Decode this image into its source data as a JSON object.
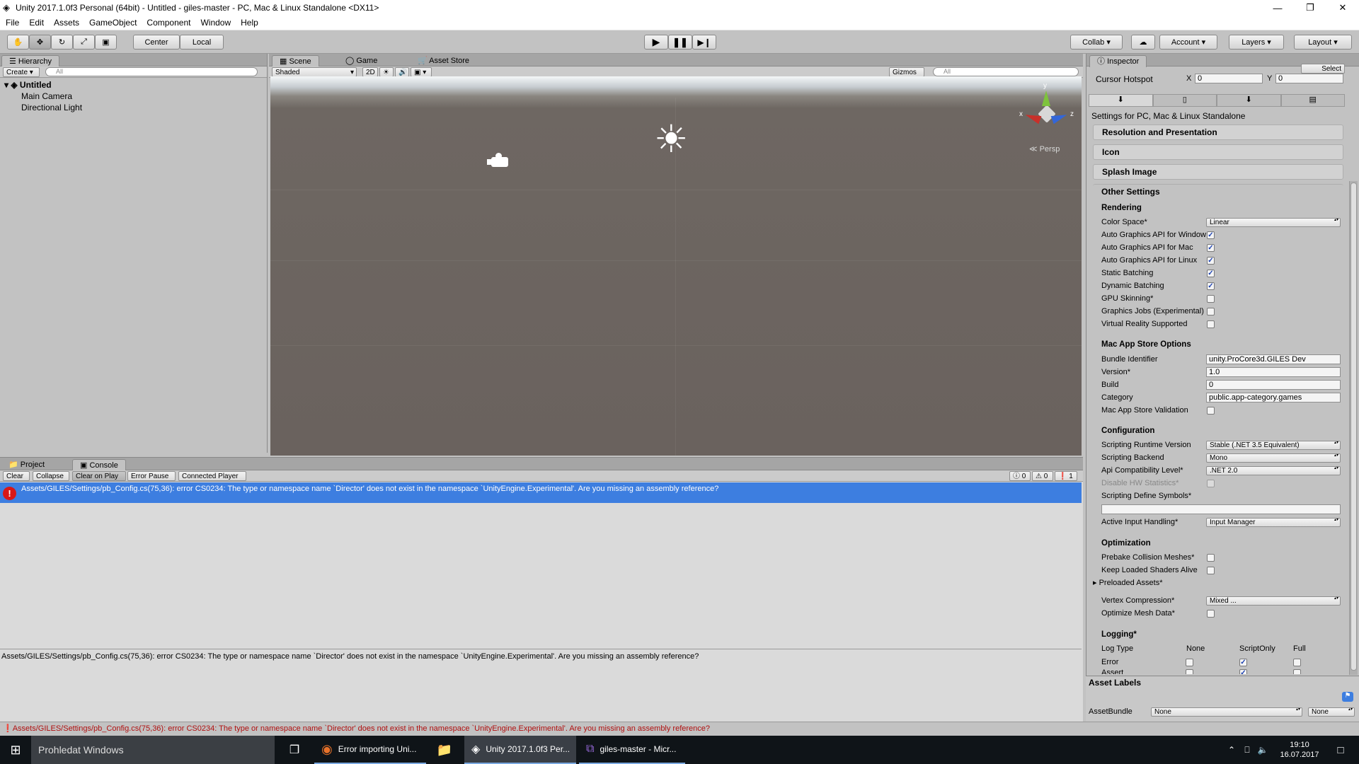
{
  "window": {
    "title": "Unity 2017.1.0f3 Personal (64bit) - Untitled - giles-master - PC, Mac & Linux Standalone <DX11>"
  },
  "menu": [
    "File",
    "Edit",
    "Assets",
    "GameObject",
    "Component",
    "Window",
    "Help"
  ],
  "toolbar": {
    "center": "Center",
    "local": "Local",
    "collab": "Collab",
    "account": "Account",
    "layers": "Layers",
    "layout": "Layout"
  },
  "hierarchy": {
    "tab": "Hierarchy",
    "create": "Create",
    "search_placeholder": "All",
    "scene_name": "Untitled",
    "items": [
      "Main Camera",
      "Directional Light"
    ]
  },
  "scene": {
    "tabs": [
      "Scene",
      "Game",
      "Asset Store"
    ],
    "shading": "Shaded",
    "mode_2d": "2D",
    "gizmos": "Gizmos",
    "search_placeholder": "All",
    "persp": "Persp",
    "axis": {
      "x": "x",
      "y": "y",
      "z": "z"
    }
  },
  "bottom": {
    "tabs": [
      "Project",
      "Console"
    ],
    "buttons": [
      "Clear",
      "Collapse",
      "Clear on Play",
      "Error Pause",
      "Connected Player"
    ],
    "counts": {
      "info": "0",
      "warn": "0",
      "error": "1"
    },
    "log_entry": "Assets/GILES/Settings/pb_Config.cs(75,36): error CS0234: The type or namespace name `Director' does not exist in the namespace `UnityEngine.Experimental'. Are you missing an assembly reference?",
    "detail": "Assets/GILES/Settings/pb_Config.cs(75,36): error CS0234: The type or namespace name `Director' does not exist in the namespace `UnityEngine.Experimental'. Are you missing an assembly reference?"
  },
  "status_bar": "Assets/GILES/Settings/pb_Config.cs(75,36): error CS0234: The type or namespace name `Director' does not exist in the namespace `UnityEngine.Experimental'. Are you missing an assembly reference?",
  "inspector": {
    "tab": "Inspector",
    "select": "Select",
    "cursor_hotspot": {
      "label": "Cursor Hotspot",
      "x_label": "X",
      "x": "0",
      "y_label": "Y",
      "y": "0"
    },
    "settings_for": "Settings for PC, Mac & Linux Standalone",
    "sections": [
      "Resolution and Presentation",
      "Icon",
      "Splash Image",
      "Other Settings"
    ],
    "rendering": {
      "heading": "Rendering",
      "color_space_label": "Color Space*",
      "color_space": "Linear",
      "checks": [
        {
          "label": "Auto Graphics API for Windows",
          "checked": true
        },
        {
          "label": "Auto Graphics API for Mac",
          "checked": true
        },
        {
          "label": "Auto Graphics API for Linux",
          "checked": true
        },
        {
          "label": "Static Batching",
          "checked": true
        },
        {
          "label": "Dynamic Batching",
          "checked": true
        },
        {
          "label": "GPU Skinning*",
          "checked": false
        },
        {
          "label": "Graphics Jobs (Experimental)",
          "checked": false
        },
        {
          "label": "Virtual Reality Supported",
          "checked": false
        }
      ]
    },
    "mac": {
      "heading": "Mac App Store Options",
      "bundle_label": "Bundle Identifier",
      "bundle": "unity.ProCore3d.GILES Dev",
      "version_label": "Version*",
      "version": "1.0",
      "build_label": "Build",
      "build": "0",
      "category_label": "Category",
      "category": "public.app-category.games",
      "validation_label": "Mac App Store Validation"
    },
    "config": {
      "heading": "Configuration",
      "runtime_label": "Scripting Runtime Version",
      "runtime": "Stable (.NET 3.5 Equivalent)",
      "backend_label": "Scripting Backend",
      "backend": "Mono",
      "api_label": "Api Compatibility Level*",
      "api": ".NET 2.0",
      "hwstats_label": "Disable HW Statistics*",
      "define_label": "Scripting Define Symbols*",
      "input_label": "Active Input Handling*",
      "input": "Input Manager"
    },
    "optim": {
      "heading": "Optimization",
      "prebake_label": "Prebake Collision Meshes*",
      "keep_label": "Keep Loaded Shaders Alive",
      "preloaded_label": "Preloaded Assets*",
      "vertex_label": "Vertex Compression*",
      "vertex": "Mixed ...",
      "optimize_label": "Optimize Mesh Data*"
    },
    "logging": {
      "heading": "Logging*",
      "col_type": "Log Type",
      "col_none": "None",
      "col_script": "ScriptOnly",
      "col_full": "Full",
      "rows": [
        "Error",
        "Assert"
      ]
    },
    "asset_labels": "Asset Labels",
    "assetbundle_label": "AssetBundle",
    "assetbundle": "None",
    "variant": "None"
  },
  "taskbar": {
    "search": "Prohledat Windows",
    "apps": [
      "Error importing Uni...",
      "Unity 2017.1.0f3 Per...",
      "giles-master - Micr..."
    ],
    "time": "19:10",
    "date": "16.07.2017"
  }
}
